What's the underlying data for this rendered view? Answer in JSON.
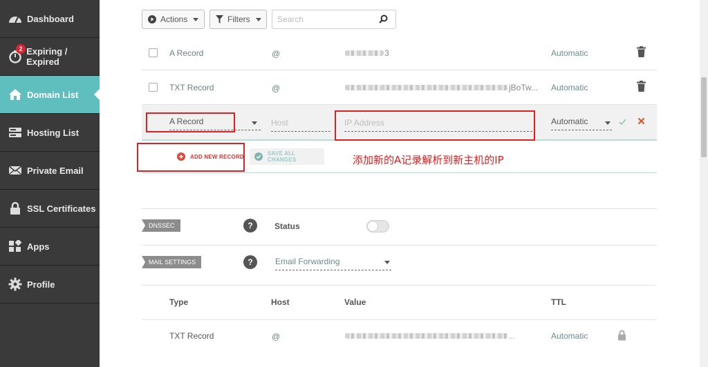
{
  "sidebar": {
    "items": [
      {
        "label": "Dashboard",
        "icon": "gauge-icon"
      },
      {
        "label": "Expiring / Expired",
        "icon": "stopwatch-icon",
        "badge": "2"
      },
      {
        "label": "Domain List",
        "icon": "home-icon",
        "active": true
      },
      {
        "label": "Hosting List",
        "icon": "server-icon"
      },
      {
        "label": "Private Email",
        "icon": "envelope-icon"
      },
      {
        "label": "SSL Certificates",
        "icon": "lock-icon"
      },
      {
        "label": "Apps",
        "icon": "apps-icon"
      },
      {
        "label": "Profile",
        "icon": "gear-icon"
      }
    ]
  },
  "toolbar": {
    "actions_label": "Actions",
    "filters_label": "Filters",
    "search_placeholder": "Search"
  },
  "records": [
    {
      "type": "A Record",
      "host": "@",
      "value_tail": "3",
      "ttl": "Automatic"
    },
    {
      "type": "TXT Record",
      "host": "@",
      "value_tail": "jBoTw...",
      "ttl": "Automatic"
    }
  ],
  "new_record": {
    "type": "A Record",
    "host_placeholder": "Host",
    "value_placeholder": "IP Address",
    "ttl": "Automatic",
    "add_label": "ADD NEW RECORD",
    "save_label": "SAVE ALL CHANGES"
  },
  "annotation": "添加新的A记录解析到新主机的IP",
  "dnssec": {
    "tag": "DNSSEC",
    "help": "?",
    "status_label": "Status",
    "enabled": false
  },
  "mail": {
    "tag": "MAIL SETTINGS",
    "help": "?",
    "selected": "Email Forwarding"
  },
  "mail_table": {
    "headers": [
      "Type",
      "Host",
      "Value",
      "TTL"
    ],
    "rows": [
      {
        "type": "TXT Record",
        "host": "@",
        "value_tail": "...",
        "ttl": "Automatic"
      }
    ]
  },
  "colors": {
    "accent": "#5fbfbf",
    "sidebar": "#3a3a3a",
    "badge": "#d9232f",
    "annotation": "#e02020",
    "add_icon": "#e0463a",
    "save_icon": "#7fb3b3"
  }
}
